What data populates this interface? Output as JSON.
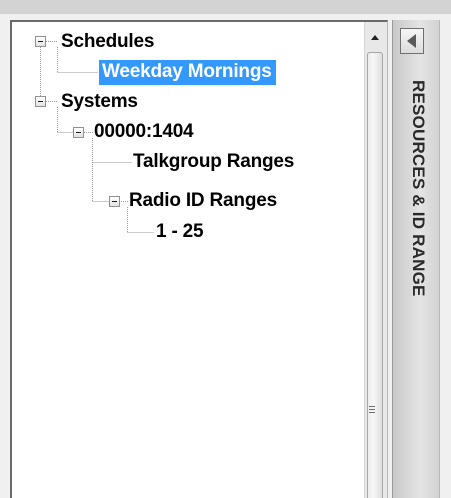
{
  "tree": {
    "nodes": [
      {
        "label": "Schedules",
        "depth": 0,
        "expanded": true
      },
      {
        "label": "Weekday Mornings",
        "depth": 1,
        "selected": true
      },
      {
        "label": "Systems",
        "depth": 0,
        "expanded": true
      },
      {
        "label": "00000:1404",
        "depth": 1,
        "expanded": true
      },
      {
        "label": "Talkgroup Ranges",
        "depth": 2
      },
      {
        "label": "Radio ID Ranges",
        "depth": 2,
        "expanded": true
      },
      {
        "label": "1 - 25",
        "depth": 3
      }
    ],
    "selection_color": "#3399ff"
  },
  "side_panel": {
    "title": "RESOURCES & ID RANGE",
    "collapse_icon": "triangle-left-icon"
  }
}
